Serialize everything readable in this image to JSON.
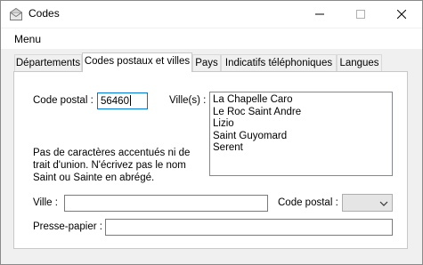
{
  "window": {
    "title": "Codes",
    "icon": "envelope-icon",
    "controls": [
      "minimize-icon",
      "maximize-icon",
      "close-icon"
    ]
  },
  "menu": {
    "items": [
      "Menu"
    ]
  },
  "tabs": [
    {
      "label": "Départements",
      "active": false
    },
    {
      "label": "Codes postaux et villes",
      "active": true
    },
    {
      "label": "Pays",
      "active": false
    },
    {
      "label": "Indicatifs téléphoniques",
      "active": false
    },
    {
      "label": "Langues",
      "active": false
    }
  ],
  "form": {
    "code_postal_label": "Code postal :",
    "code_postal_value": "56460",
    "villes_label": "Ville(s) :",
    "villes": [
      "La Chapelle Caro",
      "Le Roc Saint Andre",
      "Lizio",
      "Saint Guyomard",
      "Serent"
    ],
    "help_text": "Pas de caractères accentués ni de trait d'union. N'écrivez pas le nom Saint ou Sainte en abrégé.",
    "ville_label": "Ville :",
    "ville_value": "",
    "code_postal2_label": "Code postal :",
    "code_postal2_selected": "",
    "presse_papier_label": "Presse-papier :",
    "presse_papier_value": ""
  },
  "colors": {
    "focus_border": "#0078d7",
    "window_bg": "#f0f0f0",
    "panel_bg": "#ffffff"
  }
}
